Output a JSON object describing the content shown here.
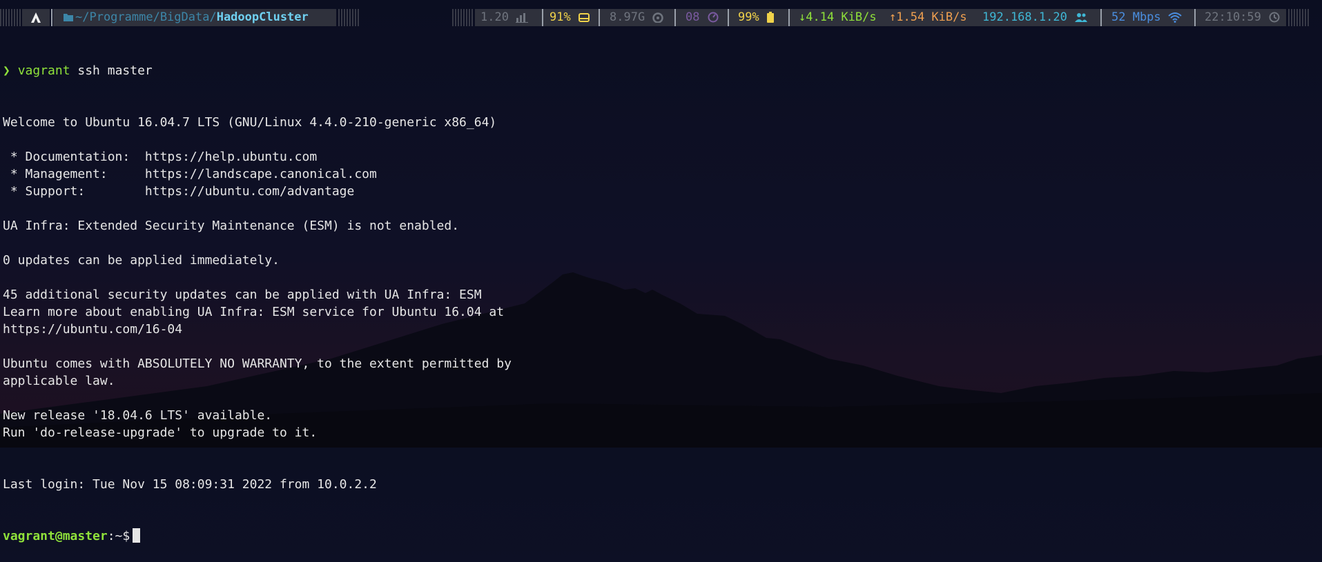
{
  "colors": {
    "bar_bg": "#2f313c",
    "path_dim": "#3c86a8",
    "path_bold": "#6fd0f0",
    "green": "#8fe13a",
    "yellow": "#f0d24a",
    "orange": "#f0a050",
    "cyan": "#3fb7d5",
    "blue": "#4a8ee0",
    "gray": "#8b8f99",
    "purple": "#7a5aa0"
  },
  "statusbar": {
    "path_prefix": "~/Programme/BigData/",
    "path_current": "HadoopCluster",
    "load": "1.20",
    "disk_percent": "91%",
    "memory": "8.97G",
    "gpu": "08",
    "battery": "99%",
    "net_down": "↓4.14 KiB/s",
    "net_up": "↑1.54 KiB/s",
    "ip": "192.168.1.20",
    "wifi_speed": "52 Mbps",
    "time": "22:10:59",
    "icons": [
      "arch-logo-icon",
      "folder-icon",
      "cpu-chart-icon",
      "disk-icon",
      "memory-icon",
      "gpu-icon",
      "battery-icon",
      "users-icon",
      "wifi-icon",
      "clock-icon"
    ]
  },
  "terminal": {
    "prompt_symbol": "❯",
    "command_prog": "vagrant",
    "command_args": " ssh master",
    "output_lines": [
      "Welcome to Ubuntu 16.04.7 LTS (GNU/Linux 4.4.0-210-generic x86_64)",
      "",
      " * Documentation:  https://help.ubuntu.com",
      " * Management:     https://landscape.canonical.com",
      " * Support:        https://ubuntu.com/advantage",
      "",
      "UA Infra: Extended Security Maintenance (ESM) is not enabled.",
      "",
      "0 updates can be applied immediately.",
      "",
      "45 additional security updates can be applied with UA Infra: ESM",
      "Learn more about enabling UA Infra: ESM service for Ubuntu 16.04 at",
      "https://ubuntu.com/16-04",
      "",
      "Ubuntu comes with ABSOLUTELY NO WARRANTY, to the extent permitted by",
      "applicable law.",
      "",
      "New release '18.04.6 LTS' available.",
      "Run 'do-release-upgrade' to upgrade to it.",
      "",
      "",
      "Last login: Tue Nov 15 08:09:31 2022 from 10.0.2.2"
    ],
    "shell_prompt_user": "vagrant@master",
    "shell_prompt_path": ":~$"
  }
}
